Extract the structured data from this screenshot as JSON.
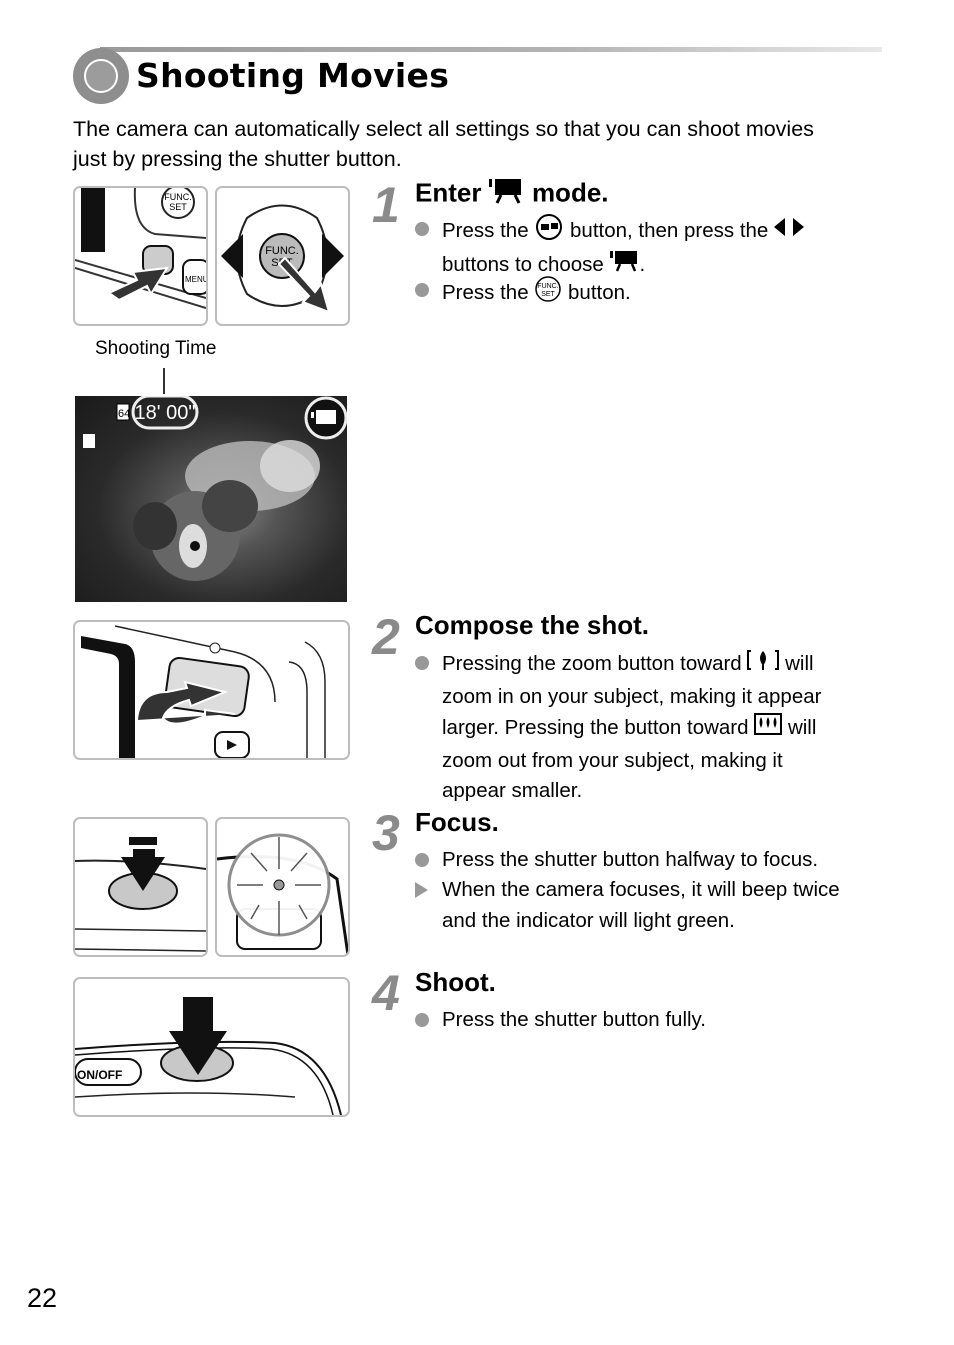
{
  "header": {
    "title": "Shooting Movies",
    "intro": "The camera can automatically select all settings so that you can shoot movies just by pressing the shutter button."
  },
  "steps": [
    {
      "number": "1",
      "heading_pre": "Enter",
      "heading_icon": "movie-mode-icon",
      "heading_post": "mode.",
      "bullets": [
        {
          "marker": "circle",
          "parts": [
            "Press the",
            "button, then press the",
            "buttons to choose",
            "."
          ],
          "icons": [
            "mode-switch-button-icon",
            "left-right-arrows-icon",
            "movie-mode-icon"
          ]
        },
        {
          "marker": "circle",
          "parts": [
            "Press the",
            "button."
          ],
          "icons": [
            "func-set-button-icon"
          ]
        }
      ]
    },
    {
      "number": "2",
      "heading": "Compose the shot.",
      "bullets": [
        {
          "marker": "circle",
          "lines": [
            "Pressing the zoom button toward",
            "will",
            "zoom in on your subject, making it appear",
            "larger. Pressing the button toward",
            "will",
            "zoom out from your subject, making it",
            "appear smaller."
          ],
          "icons": [
            "telephoto-icon",
            "wide-angle-icon"
          ]
        }
      ]
    },
    {
      "number": "3",
      "heading": "Focus.",
      "bullets": [
        {
          "marker": "circle",
          "text": "Press the shutter button halfway to focus."
        },
        {
          "marker": "triangle",
          "lines": [
            "When the camera focuses, it will beep twice",
            "and the indicator will light green."
          ]
        }
      ]
    },
    {
      "number": "4",
      "heading": "Shoot.",
      "bullets": [
        {
          "marker": "circle",
          "text": "Press the shutter button fully."
        }
      ]
    }
  ],
  "illustrations": {
    "shooting_time_caption": "Shooting Time",
    "shooting_time_value": "18' 00\"",
    "memory_label": "64",
    "func_label_1": "FUNC.",
    "func_label_2": "SET",
    "menu_label": "MENU",
    "on_off_label": "ON/OFF"
  },
  "page_number": "22"
}
